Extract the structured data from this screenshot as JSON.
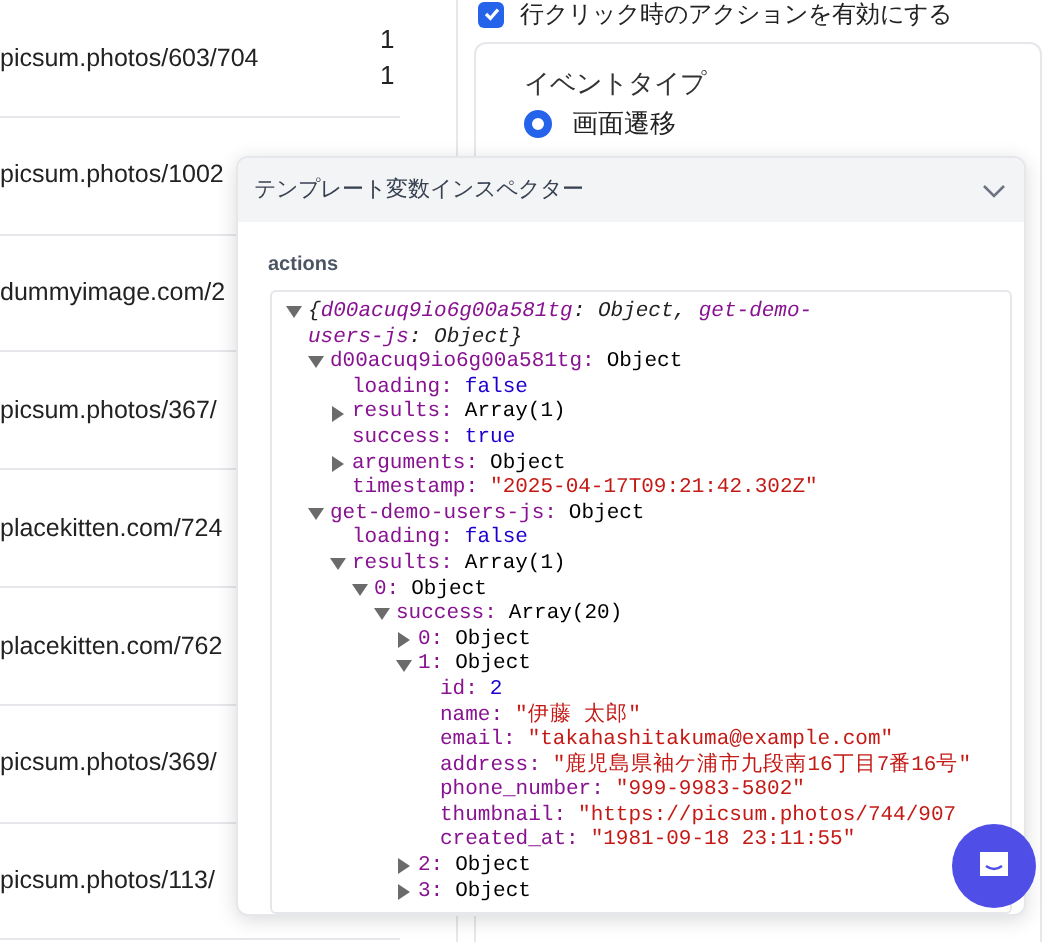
{
  "table": {
    "rows": [
      {
        "column_1": "picsum.photos/603/704",
        "column_2": [
          "1",
          "1"
        ]
      },
      {
        "column_1": "picsum.photos/1002",
        "column_2": []
      },
      {
        "column_1": "dummyimage.com/2",
        "column_2": []
      },
      {
        "column_1": "picsum.photos/367/",
        "column_2": []
      },
      {
        "column_1": "placekitten.com/724",
        "column_2": []
      },
      {
        "column_1": "placekitten.com/762",
        "column_2": []
      },
      {
        "column_1": "picsum.photos/369/",
        "column_2": []
      },
      {
        "column_1": "picsum.photos/113/",
        "column_2": []
      }
    ]
  },
  "settings": {
    "row_click_action": {
      "label": "行クリック時のアクションを有効にする",
      "checked": true
    },
    "event_type": {
      "label": "イベントタイプ",
      "options": [
        {
          "label": "画面遷移",
          "selected": true
        }
      ]
    }
  },
  "inspector": {
    "title": "テンプレート変数インスペクター",
    "expanded": true,
    "section": "actions",
    "tree": {
      "expanded": true,
      "summary": [
        {
          "text": "{",
          "kind": "punct"
        },
        {
          "text": "d00acuq9io6g00a581tg",
          "kind": "key"
        },
        {
          "text": ": Object, ",
          "kind": "punct"
        },
        {
          "text": "get-demo-users-js",
          "kind": "key"
        },
        {
          "text": ": Object}",
          "kind": "punct"
        }
      ],
      "children": [
        {
          "key": "d00acuq9io6g00a581tg:",
          "value": "Object",
          "kind": "object",
          "expanded": true,
          "children": [
            {
              "key": "loading:",
              "value": "false",
              "kind": "boolean"
            },
            {
              "key": "results:",
              "value": "Array(1)",
              "kind": "object",
              "expanded": false
            },
            {
              "key": "success:",
              "value": "true",
              "kind": "boolean"
            },
            {
              "key": "arguments:",
              "value": "Object",
              "kind": "object",
              "expanded": false
            },
            {
              "key": "timestamp:",
              "value": "\"2025-04-17T09:21:42.302Z\"",
              "kind": "string"
            }
          ]
        },
        {
          "key": "get-demo-users-js:",
          "value": "Object",
          "kind": "object",
          "expanded": true,
          "children": [
            {
              "key": "loading:",
              "value": "false",
              "kind": "boolean"
            },
            {
              "key": "results:",
              "value": "Array(1)",
              "kind": "object",
              "expanded": true,
              "children": [
                {
                  "key": "0:",
                  "value": "Object",
                  "kind": "object",
                  "expanded": true,
                  "children": [
                    {
                      "key": "success:",
                      "value": "Array(20)",
                      "kind": "object",
                      "expanded": true,
                      "children": [
                        {
                          "key": "0:",
                          "value": "Object",
                          "kind": "object",
                          "expanded": false
                        },
                        {
                          "key": "1:",
                          "value": "Object",
                          "kind": "object",
                          "expanded": true,
                          "children": [
                            {
                              "key": "id:",
                              "value": "2",
                              "kind": "number"
                            },
                            {
                              "key": "name:",
                              "value": "\"伊藤 太郎\"",
                              "kind": "string"
                            },
                            {
                              "key": "email:",
                              "value": "\"takahashitakuma@example.com\"",
                              "kind": "string"
                            },
                            {
                              "key": "address:",
                              "value": "\"鹿児島県袖ケ浦市九段南16丁目7番16号\"",
                              "kind": "string"
                            },
                            {
                              "key": "phone_number:",
                              "value": "\"999-9983-5802\"",
                              "kind": "string"
                            },
                            {
                              "key": "thumbnail:",
                              "value": "\"https://picsum.photos/744/907",
                              "kind": "string"
                            },
                            {
                              "key": "created_at:",
                              "value": "\"1981-09-18 23:11:55\"",
                              "kind": "string"
                            }
                          ]
                        },
                        {
                          "key": "2:",
                          "value": "Object",
                          "kind": "object",
                          "expanded": false
                        },
                        {
                          "key": "3:",
                          "value": "Object",
                          "kind": "object",
                          "expanded": false
                        }
                      ]
                    }
                  ]
                }
              ]
            }
          ]
        }
      ]
    }
  }
}
